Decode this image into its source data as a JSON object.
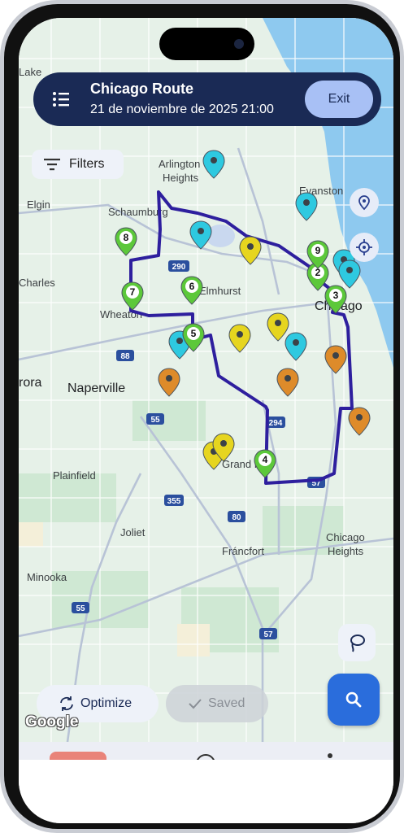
{
  "header": {
    "title": "Chicago Route",
    "subtitle": "21 de noviembre de 2025 21:00",
    "exit_label": "Exit"
  },
  "filters_label": "Filters",
  "actions": {
    "optimize_label": "Optimize",
    "saved_label": "Saved"
  },
  "map": {
    "attribution": "Google",
    "place_labels": [
      "Lake",
      "Arlington",
      "Heights",
      "Evanston",
      "Elgin",
      "Schaumburg",
      "Charles",
      "Elmhurst",
      "Chicago",
      "Wheaton",
      "rora",
      "Naperville",
      "Plainfield",
      "Grand P",
      "Joliet",
      "Fráncfort",
      "Chicago",
      "Heights",
      "Minooka"
    ],
    "highway_labels": [
      "290",
      "88",
      "55",
      "294",
      "355",
      "80",
      "57",
      "55",
      "57"
    ],
    "route_stops": [
      "2",
      "3",
      "4",
      "5",
      "6",
      "7",
      "8",
      "9"
    ],
    "route_color": "#2e1f9e",
    "marker_colors": {
      "stop": "#5cc83a",
      "cyan": "#2ec9e0",
      "yellow": "#e6d51f",
      "orange": "#de8b2a"
    }
  },
  "colors": {
    "header_bg": "#1a2a55",
    "exit_bg": "#a8c0f5",
    "fab": "#2a6ddc",
    "water": "#8ec9ef",
    "land": "#e6f1e8"
  }
}
